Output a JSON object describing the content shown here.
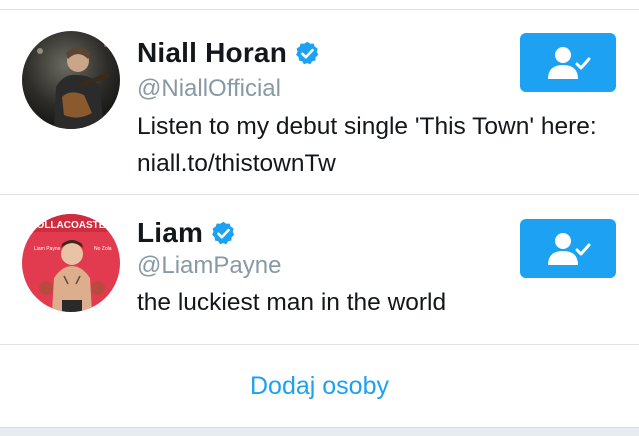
{
  "suggestions": [
    {
      "name": "Niall Horan",
      "handle": "@NiallOfficial",
      "bio": "Listen to my debut single 'This Town' here: niall.to/thistownTw",
      "verified": true,
      "following": true,
      "avatar_icon": "avatar-photo-guitarist"
    },
    {
      "name": "Liam",
      "handle": "@LiamPayne",
      "bio": "the luckiest man in the world",
      "verified": true,
      "following": true,
      "avatar_icon": "avatar-photo-magazine-cover",
      "avatar_text": {
        "masthead": "ROLLACOASTER",
        "left_caption": "Liam Payne",
        "right_caption": "No Zola"
      }
    }
  ],
  "footer": {
    "add_people_label": "Dodaj osoby"
  },
  "colors": {
    "accent": "#1da1f2",
    "text": "#14171a",
    "secondary_text": "#8899a6",
    "divider": "#dcdfe3"
  },
  "icons": {
    "verified": "verified-badge-icon",
    "follow": "following-person-check-icon"
  }
}
